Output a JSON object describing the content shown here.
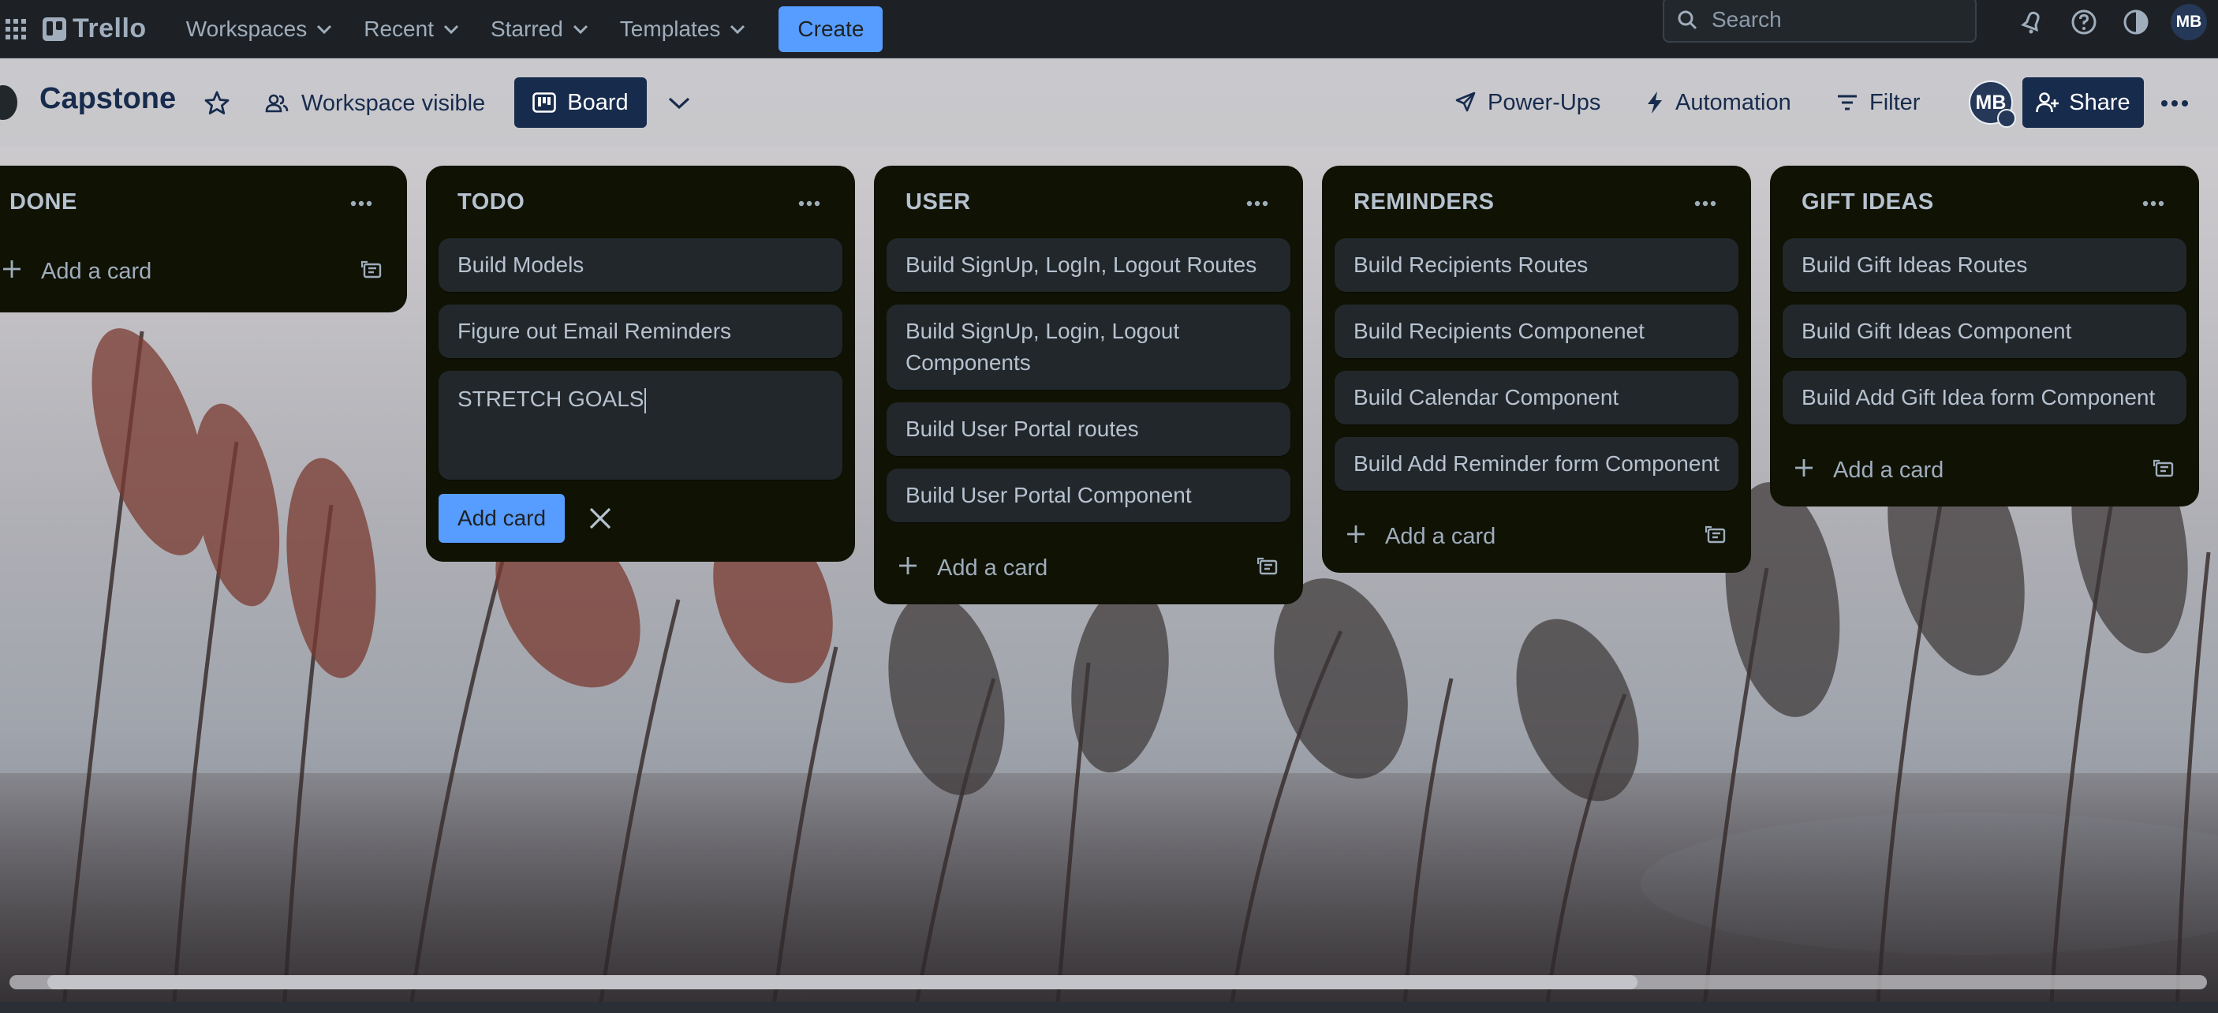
{
  "app": {
    "brand": "Trello",
    "accent": "#579dff"
  },
  "topnav": {
    "menus": [
      {
        "label": "Workspaces"
      },
      {
        "label": "Recent"
      },
      {
        "label": "Starred"
      },
      {
        "label": "Templates"
      }
    ],
    "create_label": "Create",
    "search_placeholder": "Search",
    "avatar_initials": "MB"
  },
  "board": {
    "title": "Capstone",
    "visibility_label": "Workspace visible",
    "view_label": "Board",
    "powerups_label": "Power-Ups",
    "automation_label": "Automation",
    "filter_label": "Filter",
    "member_initials": "MB",
    "share_label": "Share"
  },
  "lists": [
    {
      "title": "DONE",
      "cards": [],
      "add_label": "Add a card"
    },
    {
      "title": "TODO",
      "cards": [
        "Build Models",
        "Figure out Email Reminders"
      ],
      "composer": {
        "text": "STRETCH GOALS",
        "add_button": "Add card"
      }
    },
    {
      "title": "USER",
      "cards": [
        "Build SignUp, LogIn, Logout Routes",
        "Build SignUp, Login, Logout Components",
        "Build User Portal routes",
        "Build User Portal Component"
      ],
      "add_label": "Add a card"
    },
    {
      "title": "REMINDERS",
      "cards": [
        "Build Recipients Routes",
        "Build Recipients Componenet",
        "Build Calendar Component",
        "Build Add Reminder form Component"
      ],
      "add_label": "Add a card"
    },
    {
      "title": "GIFT IDEAS",
      "cards": [
        "Build Gift Ideas Routes",
        "Build Gift Ideas Component",
        "Build Add Gift Idea form Component"
      ],
      "add_label": "Add a card"
    }
  ]
}
